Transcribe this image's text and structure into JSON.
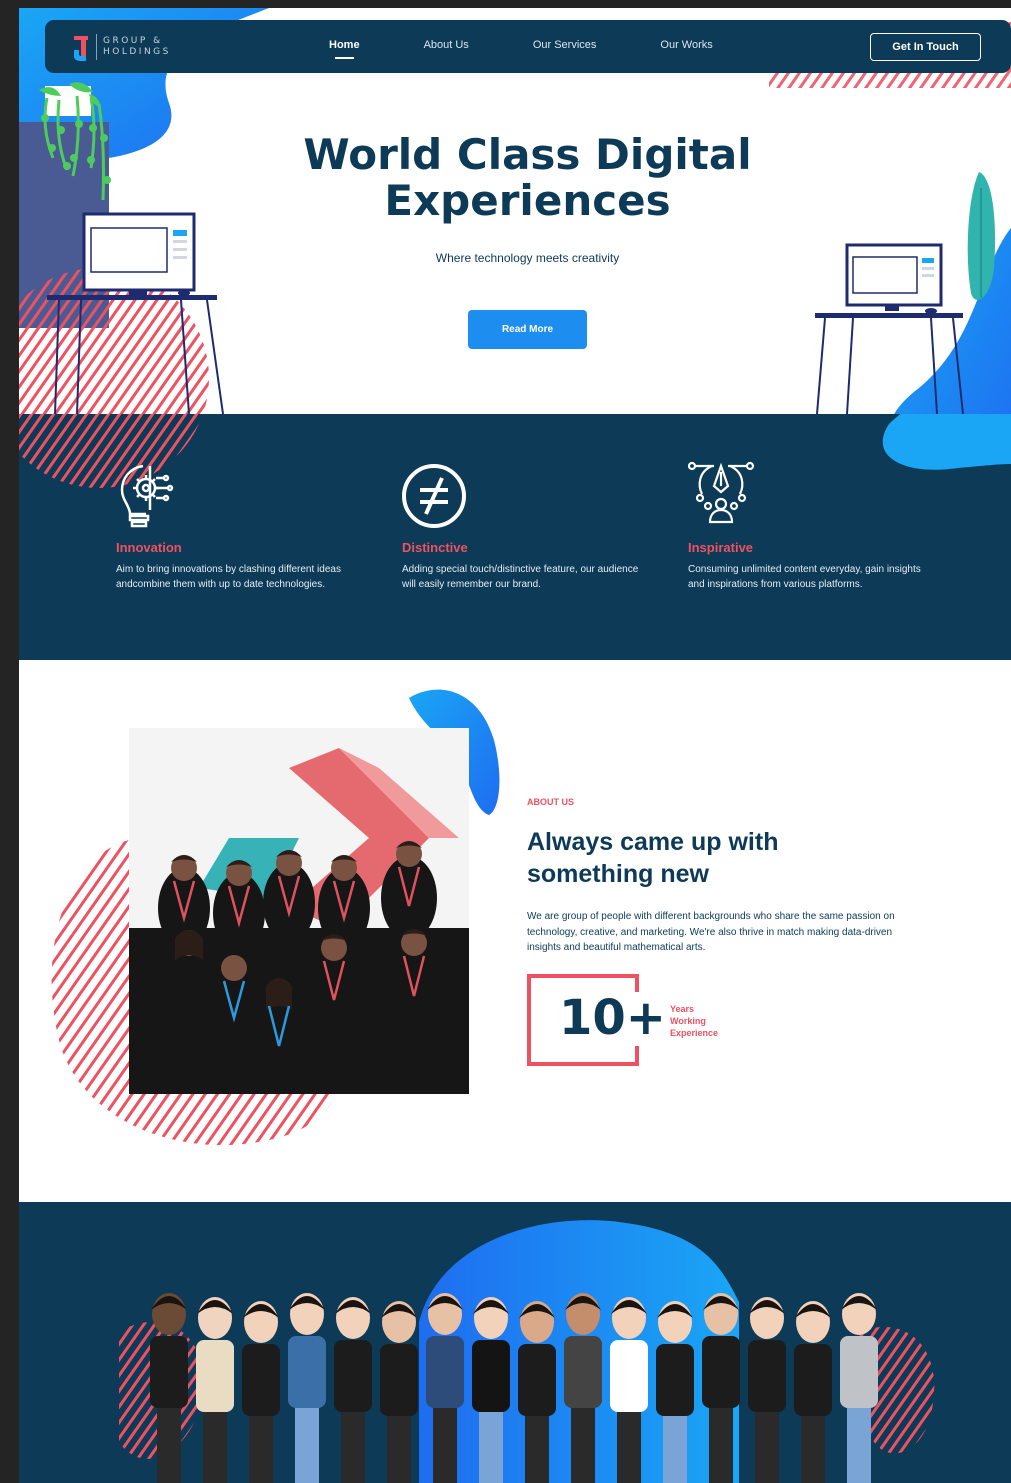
{
  "brand": {
    "logo_text_line1": "GROUP &",
    "logo_text_line2": "HOLDINGS"
  },
  "nav": {
    "items": [
      {
        "label": "Home",
        "active": true
      },
      {
        "label": "About Us",
        "active": false
      },
      {
        "label": "Our Services",
        "active": false
      },
      {
        "label": "Our Works",
        "active": false
      }
    ],
    "cta_label": "Get In Touch"
  },
  "hero": {
    "title_line1": "World Class Digital",
    "title_line2": "Experiences",
    "subtitle": "Where technology meets creativity",
    "button_label": "Read More"
  },
  "features": [
    {
      "icon": "lightbulb-gear-icon",
      "title": "Innovation",
      "description": "Aim to bring innovations by clashing different ideas andcombine them with up to date technologies."
    },
    {
      "icon": "not-equal-icon",
      "title": "Distinctive",
      "description": "Adding special touch/distinctive feature, our audience will easily remember our brand."
    },
    {
      "icon": "pen-tool-person-icon",
      "title": "Inspirative",
      "description": "Consuming unlimited content everyday, gain insights and inspirations from various platforms."
    }
  ],
  "about": {
    "label": "ABOUT US",
    "title_line1": "Always came up with",
    "title_line2": "something new",
    "description": "We are group of people with different backgrounds who share the same passion on technology, creative, and marketing. We're also thrive in match making data-driven insights and beautiful mathematical arts.",
    "stat_number": "10+",
    "stat_caption_line1": "Years",
    "stat_caption_line2": "Working",
    "stat_caption_line3": "Experience"
  },
  "colors": {
    "navy": "#0c3a57",
    "accent_red": "#ee5261",
    "accent_blue": "#1e8df0",
    "white": "#ffffff"
  }
}
